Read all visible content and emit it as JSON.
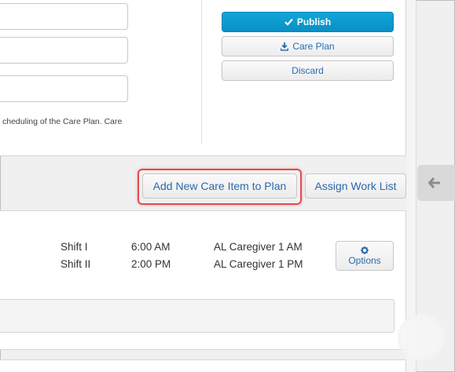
{
  "actions": {
    "publish": "Publish",
    "care_plan": "Care Plan",
    "discard": "Discard"
  },
  "help_text": "cheduling of the Care Plan. Care",
  "toolbar": {
    "add_item": "Add New Care Item to Plan",
    "assign_work_list": "Assign Work List"
  },
  "schedule": [
    {
      "shift": "Shift I",
      "time": "6:00 AM",
      "caregiver": "AL Caregiver 1 AM"
    },
    {
      "shift": "Shift II",
      "time": "2:00 PM",
      "caregiver": "AL Caregiver 1 PM"
    }
  ],
  "options_label": "Options",
  "colors": {
    "primary": "#0a9bd1",
    "link": "#2b6aad",
    "highlight": "#e24b4b"
  },
  "icons": {
    "publish": "check-icon",
    "care_plan": "download-icon",
    "side_toggle": "arrow-left-icon",
    "options": "gear-icon"
  }
}
